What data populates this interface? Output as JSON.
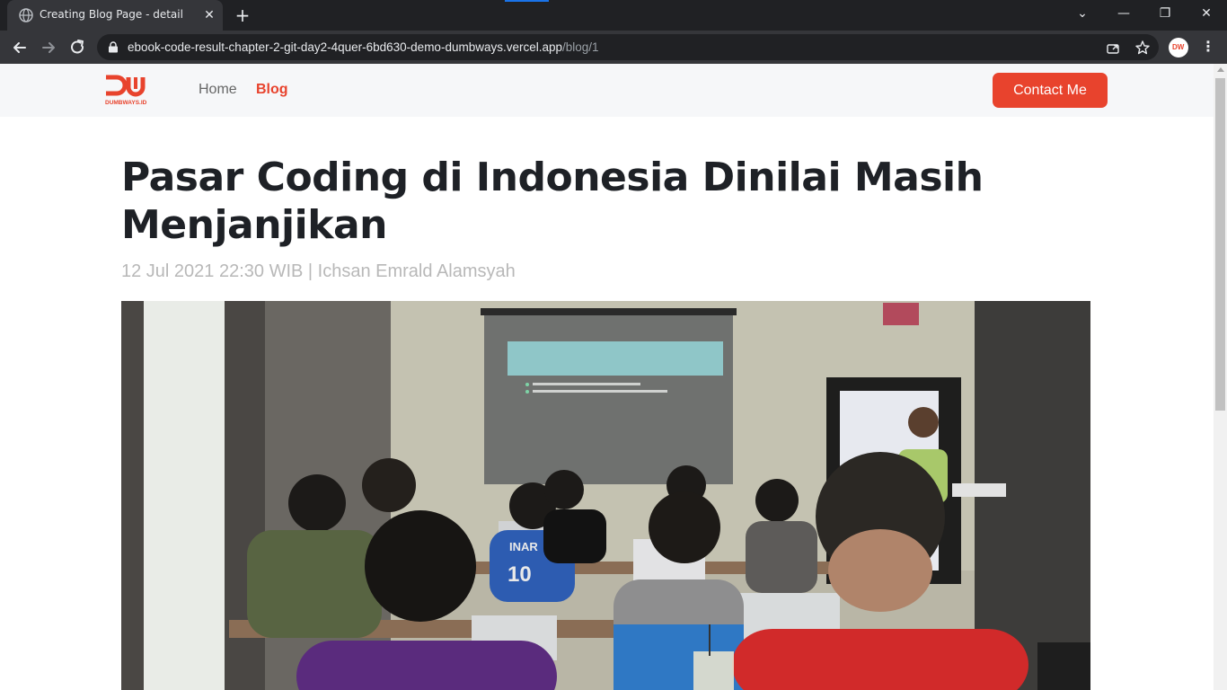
{
  "browser": {
    "tab_title": "Creating Blog Page - detail",
    "tab_close": "✕",
    "new_tab": "+",
    "url_host": "ebook-code-result-chapter-2-git-day2-4quer-6bd630-demo-dumbways.vercel.app",
    "url_path": "/blog/1",
    "profile_label": "DW",
    "menu": "⋮",
    "controls": {
      "chevron": "⌄",
      "minimize": "—",
      "restore": "❐",
      "close": "✕"
    }
  },
  "site": {
    "logo_text": "DUMBWAYS.ID",
    "brand_color": "#e8432d",
    "nav": {
      "home": "Home",
      "blog": "Blog"
    },
    "contact_label": "Contact Me"
  },
  "post": {
    "title": "Pasar Coding di Indonesia Dinilai Masih Menjanjikan",
    "meta": "12 Jul 2021 22:30 WIB | Ichsan Emrald Alamsyah",
    "image_caption": ""
  },
  "photo_texts": {
    "jersey": "INAR",
    "jersey_number": "10"
  }
}
